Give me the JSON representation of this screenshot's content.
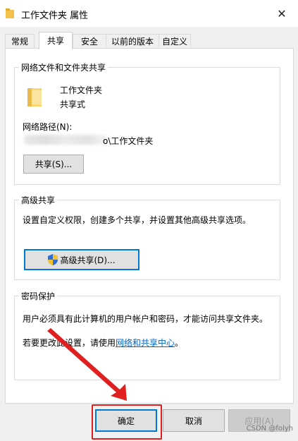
{
  "window": {
    "title": "工作文件夹 属性",
    "close_glyph": "✕"
  },
  "tabs": [
    {
      "label": "常规"
    },
    {
      "label": "共享"
    },
    {
      "label": "安全"
    },
    {
      "label": "以前的版本"
    },
    {
      "label": "自定义"
    }
  ],
  "network_share": {
    "group_title": "网络文件和文件夹共享",
    "folder_name": "工作文件夹",
    "status": "共享式",
    "path_label": "网络路径(N):",
    "path_value_suffix": "o\\工作文件夹",
    "share_button": "共享(S)..."
  },
  "advanced_share": {
    "group_title": "高级共享",
    "description": "设置自定义权限，创建多个共享，并设置其他高级共享选项。",
    "button": "高级共享(D)..."
  },
  "password": {
    "group_title": "密码保护",
    "description": "用户必须具有此计算机的用户帐户和密码，才能访问共享文件夹。",
    "change_prefix": "若要更改此设置，请使用",
    "link": "网络和共享中心",
    "change_suffix": "。"
  },
  "footer": {
    "ok": "确定",
    "cancel": "取消",
    "apply": "应用(A)"
  },
  "watermark": "CSDN @folyh",
  "colors": {
    "accent": "#0078d7",
    "annotation": "#e02020",
    "link": "#0066cc",
    "folder": "#f3c24b"
  },
  "icons": {
    "folder": "folder-icon",
    "shield": "uac-shield-icon",
    "close": "close-icon"
  }
}
